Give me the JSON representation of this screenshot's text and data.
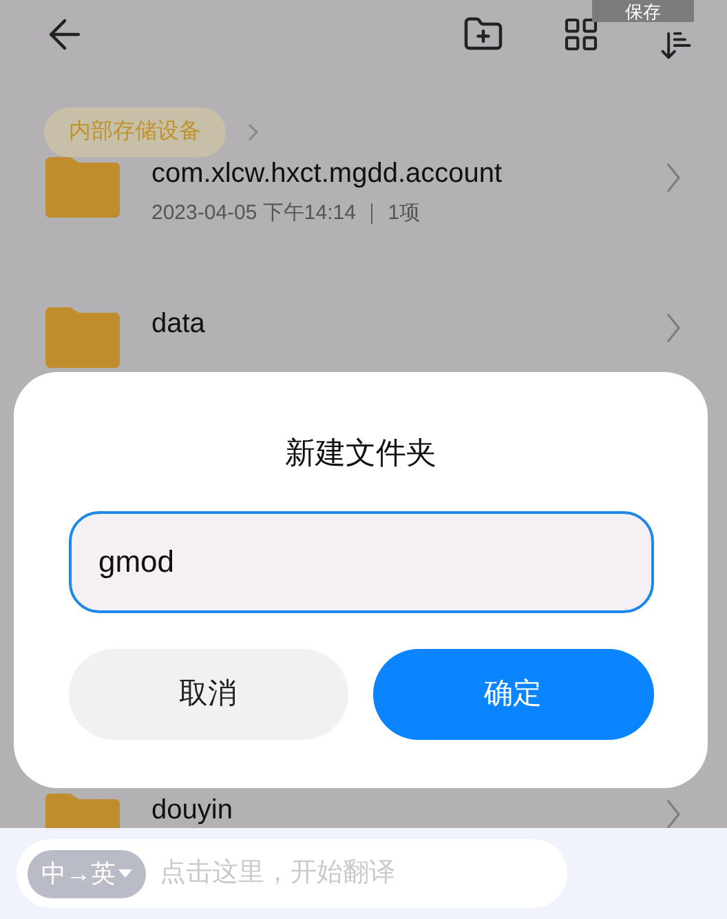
{
  "toolbar": {
    "save_label": "保存"
  },
  "breadcrumb": {
    "label": "内部存储设备"
  },
  "files": [
    {
      "name": "com.xlcw.hxct.mgdd.account",
      "meta": "2023-04-05 下午14:14 ｜ 1项"
    },
    {
      "name": "data"
    },
    {
      "name": "douyin"
    }
  ],
  "dialog": {
    "title": "新建文件夹",
    "value": "gmod",
    "buttons": [
      {
        "label": "取消",
        "kind": "secondary"
      },
      {
        "label": "确定",
        "kind": "primary"
      }
    ]
  },
  "translate_bar": {
    "language": "中→英",
    "placeholder": "点击这里，开始翻译"
  }
}
